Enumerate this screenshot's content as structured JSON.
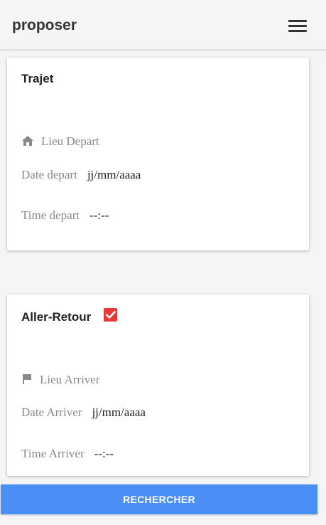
{
  "header": {
    "title": "proposer",
    "menu_icon": "hamburger-menu-icon"
  },
  "trajet": {
    "title": "Trajet",
    "lieu_depart": {
      "icon": "home-icon",
      "placeholder": "Lieu Depart"
    },
    "date_depart": {
      "label": "Date depart",
      "value": "jj/mm/aaaa"
    },
    "time_depart": {
      "label": "Time depart",
      "value": "--:--"
    }
  },
  "aller_retour": {
    "title": "Aller-Retour",
    "checked": true,
    "checkbox_color": "#e53935",
    "lieu_arriver": {
      "icon": "flag-icon",
      "placeholder": "Lieu Arriver"
    },
    "date_arriver": {
      "label": "Date Arriver",
      "value": "jj/mm/aaaa"
    },
    "time_arriver": {
      "label": "Time Arriver",
      "value": "--:--"
    }
  },
  "actions": {
    "search_label": "RECHERCHER",
    "search_color": "#4a8ff5"
  }
}
